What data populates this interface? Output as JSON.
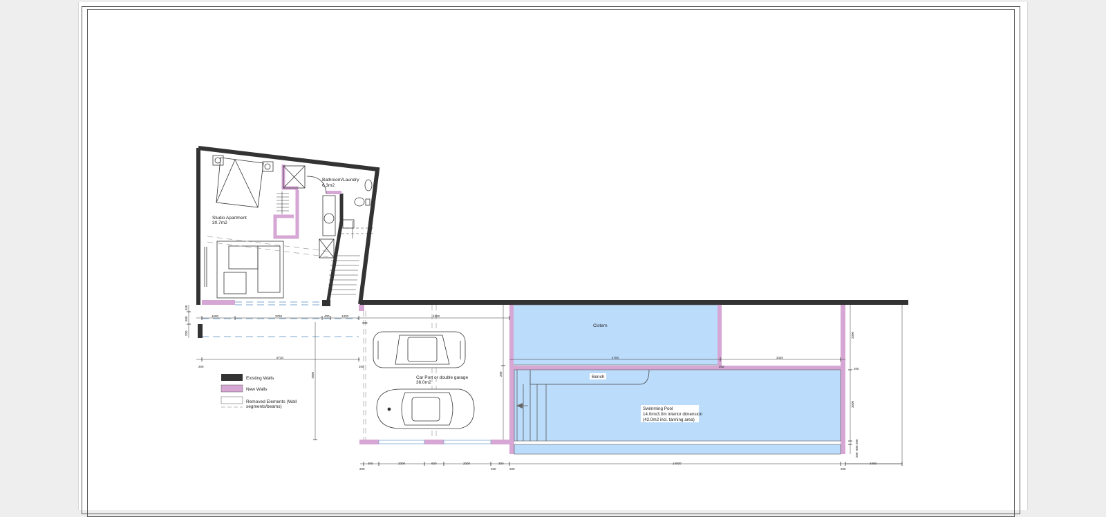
{
  "rooms": {
    "studio_name": "Studio Apartment",
    "studio_area": "30.7m2",
    "bath_name": "Bathroom/Laundry",
    "bath_area": "6.3m2",
    "carport_name": "Car Port or double garage",
    "carport_area": "36.0m2",
    "cistern": "Cistern",
    "bench": "Bench",
    "pool_name": "Swimming Pool",
    "pool_dims": "14.0mx3.0m interior dimension",
    "pool_area": "(42.0m2 incl. tanning area)"
  },
  "legend": {
    "existing": "Existing Walls",
    "new": "New Walls",
    "removed_line1": "Removed Elements (Wall",
    "removed_line2": "segments/beams)"
  },
  "dimensions": {
    "h1": [
      "1600",
      "3750",
      "400",
      "1330",
      "200"
    ],
    "total": "6720",
    "carport_w": "4300",
    "carport_h": "7800",
    "cistern_w": "4700",
    "cistern_w2": "3420",
    "bottom": [
      "200",
      "300",
      "2000",
      "600",
      "2000",
      "200",
      "300",
      "200",
      "14000",
      "200",
      "2400"
    ],
    "pool_v": [
      "2000",
      "3000",
      "200",
      "800",
      "200"
    ],
    "left_v": [
      "450",
      "600",
      "200"
    ],
    "misc": [
      "200",
      "200",
      "200",
      "200"
    ]
  },
  "colors": {
    "existing_wall": "#333333",
    "new_wall": "#d6a6d4",
    "water": "#bcdcfb"
  }
}
